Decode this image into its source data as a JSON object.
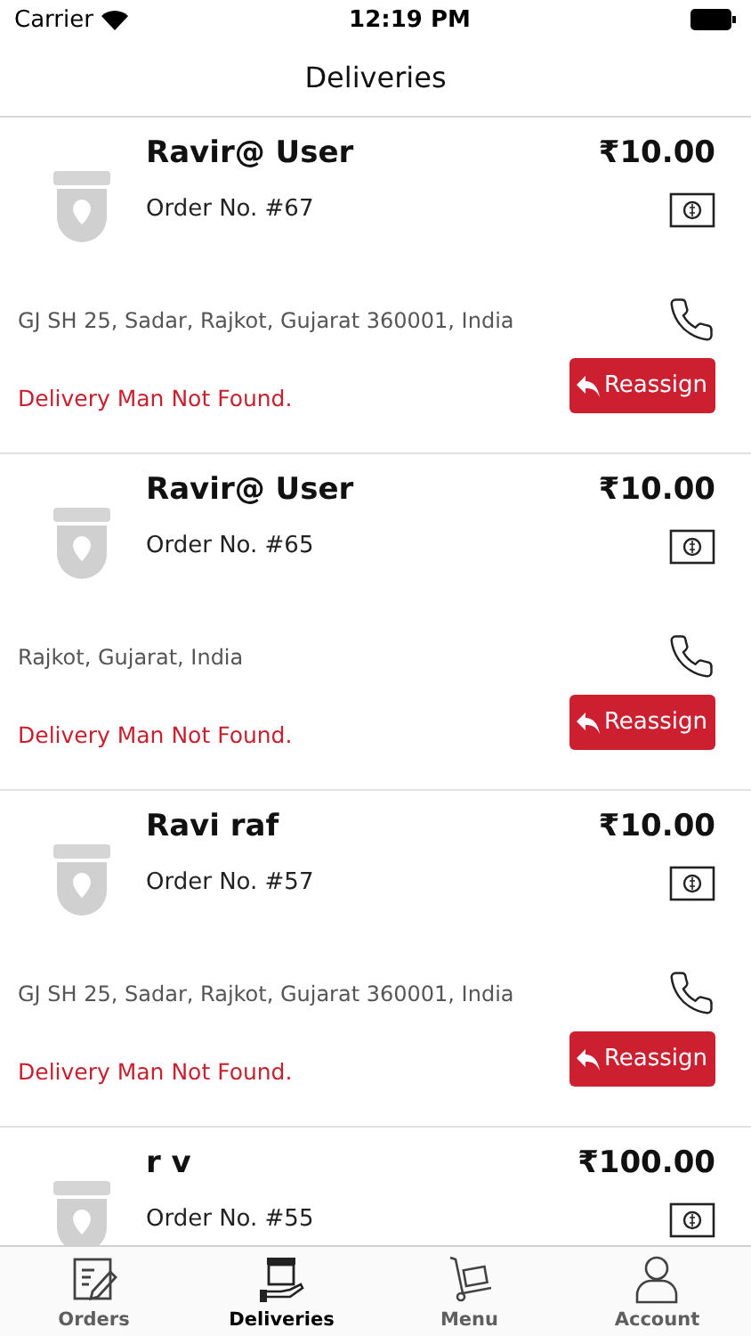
{
  "status_bar": {
    "carrier": "Carrier",
    "time": "12:19 PM"
  },
  "title": "Deliveries",
  "deliveries": [
    {
      "name": "Ravir@ User",
      "order": "Order No. #67",
      "price": "₹10.00",
      "address": "GJ SH 25, Sadar, Rajkot, Gujarat 360001, India",
      "status": "Delivery Man Not Found.",
      "action": "Reassign"
    },
    {
      "name": "Ravir@ User",
      "order": "Order No. #65",
      "price": "₹10.00",
      "address": "Rajkot, Gujarat, India",
      "status": "Delivery Man Not Found.",
      "action": "Reassign"
    },
    {
      "name": "Ravi raf",
      "order": "Order No. #57",
      "price": "₹10.00",
      "address": "GJ SH 25, Sadar, Rajkot, Gujarat 360001, India",
      "status": "Delivery Man Not Found.",
      "action": "Reassign"
    },
    {
      "name": "r v",
      "order": "Order No. #55",
      "price": "₹100.00"
    }
  ],
  "tabs": [
    {
      "label": "Orders",
      "kind": "orders",
      "selected": false
    },
    {
      "label": "Deliveries",
      "kind": "deliveries",
      "selected": true
    },
    {
      "label": "Menu",
      "kind": "menu",
      "selected": false
    },
    {
      "label": "Account",
      "kind": "account",
      "selected": false
    }
  ]
}
